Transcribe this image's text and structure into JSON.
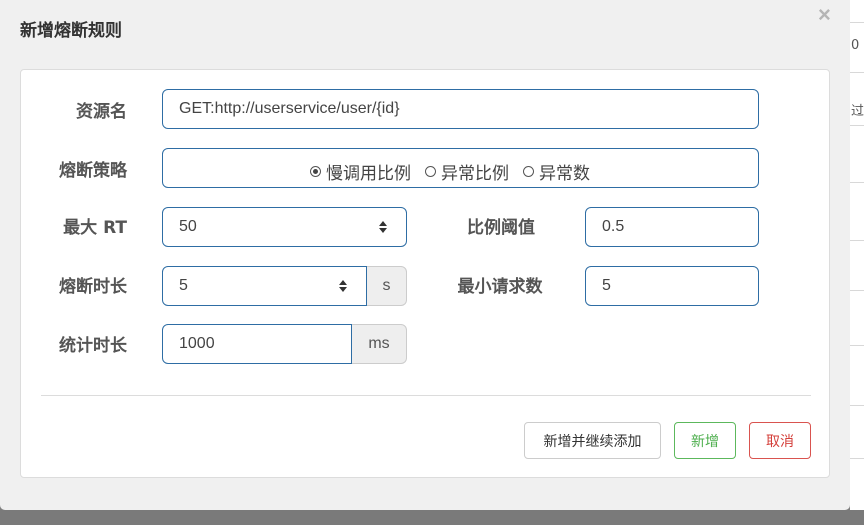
{
  "dialog": {
    "title": "新增熔断规则",
    "close": "×"
  },
  "form": {
    "resource_label": "资源名",
    "resource_value": "GET:http://userservice/user/{id}",
    "strategy_label": "熔断策略",
    "strategy_options": [
      {
        "label": "慢调用比例",
        "checked": true
      },
      {
        "label": "异常比例",
        "checked": false
      },
      {
        "label": "异常数",
        "checked": false
      }
    ],
    "max_rt_label": "最大 RT",
    "max_rt_value": "50",
    "ratio_label": "比例阈值",
    "ratio_value": "0.5",
    "duration_label": "熔断时长",
    "duration_value": "5",
    "duration_unit": "s",
    "min_request_label": "最小请求数",
    "min_request_value": "5",
    "stat_label": "统计时长",
    "stat_value": "1000",
    "stat_unit": "ms"
  },
  "footer": {
    "add_continue": "新增并继续添加",
    "add": "新增",
    "cancel": "取消"
  },
  "background": {
    "text1": "0",
    "text2": "过"
  }
}
